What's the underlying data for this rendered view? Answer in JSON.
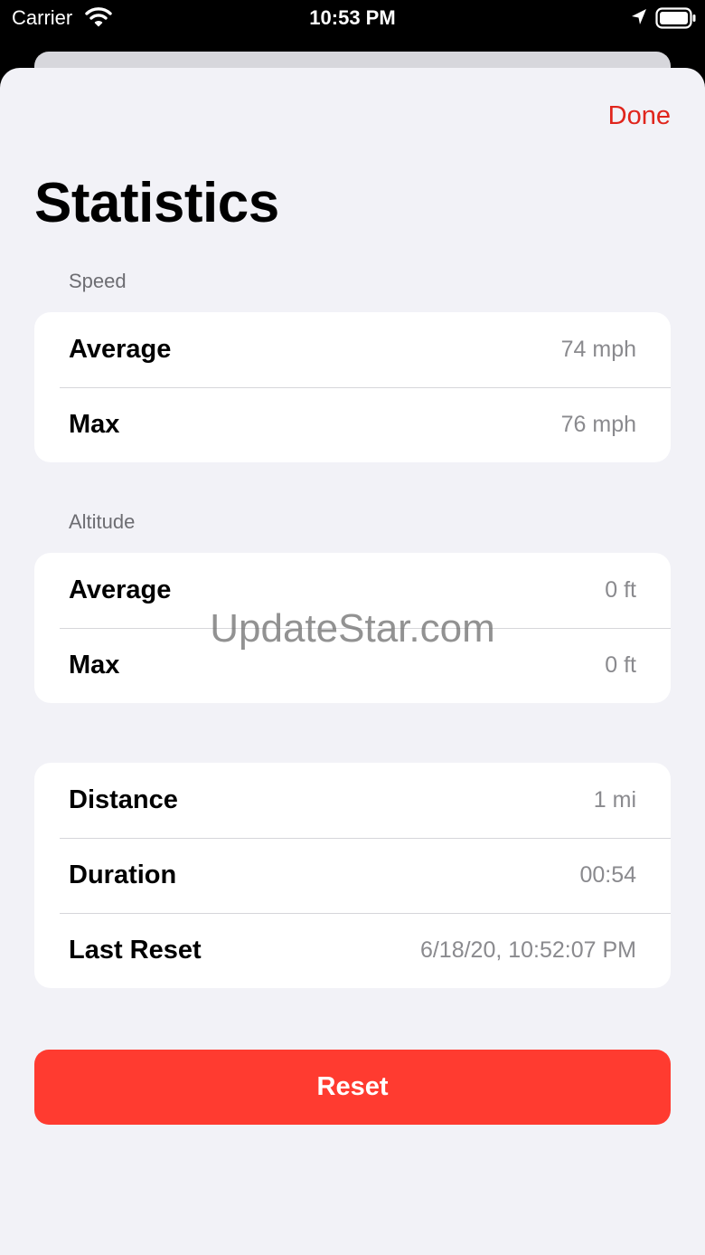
{
  "status_bar": {
    "carrier": "Carrier",
    "time": "10:53 PM",
    "icons": [
      "wifi-icon",
      "location-arrow-icon",
      "battery-icon"
    ]
  },
  "header": {
    "done_label": "Done",
    "title": "Statistics"
  },
  "speed": {
    "header": "Speed",
    "rows": [
      {
        "label": "Average",
        "value": "74 mph"
      },
      {
        "label": "Max",
        "value": "76 mph"
      }
    ]
  },
  "altitude": {
    "header": "Altitude",
    "rows": [
      {
        "label": "Average",
        "value": "0 ft"
      },
      {
        "label": "Max",
        "value": "0 ft"
      }
    ]
  },
  "trip": {
    "rows": [
      {
        "label": "Distance",
        "value": "1 mi"
      },
      {
        "label": "Duration",
        "value": "00:54"
      },
      {
        "label": "Last Reset",
        "value": "6/18/20, 10:52:07 PM"
      }
    ]
  },
  "reset_label": "Reset",
  "watermark": "UpdateStar.com",
  "colors": {
    "accent": "#e0251c",
    "reset_button": "#ff3b30",
    "sheet_background": "#f2f2f7"
  }
}
